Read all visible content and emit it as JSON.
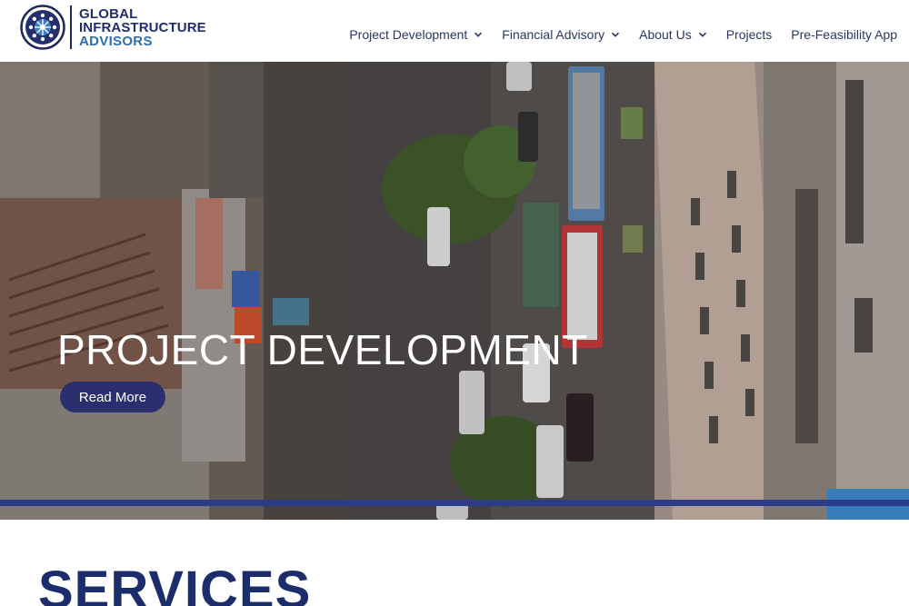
{
  "brand": {
    "line1": "GLOBAL",
    "line2": "INFRASTRUCTURE",
    "line3": "ADVISORS",
    "primary_color": "#1f2e6b",
    "accent_color": "#2c6fb0"
  },
  "nav": {
    "items": [
      {
        "label": "Project Development",
        "has_dropdown": true
      },
      {
        "label": "Financial Advisory",
        "has_dropdown": true
      },
      {
        "label": "About Us",
        "has_dropdown": true
      },
      {
        "label": "Projects",
        "has_dropdown": false
      },
      {
        "label": "Pre-Feasibility App",
        "has_dropdown": false
      }
    ]
  },
  "hero": {
    "title": "PROJECT DEVELOPMENT",
    "button_label": "Read More",
    "button_color": "#2b2f6e",
    "strip_color": "#2d3c8a"
  },
  "services": {
    "title": "SERVICES"
  }
}
